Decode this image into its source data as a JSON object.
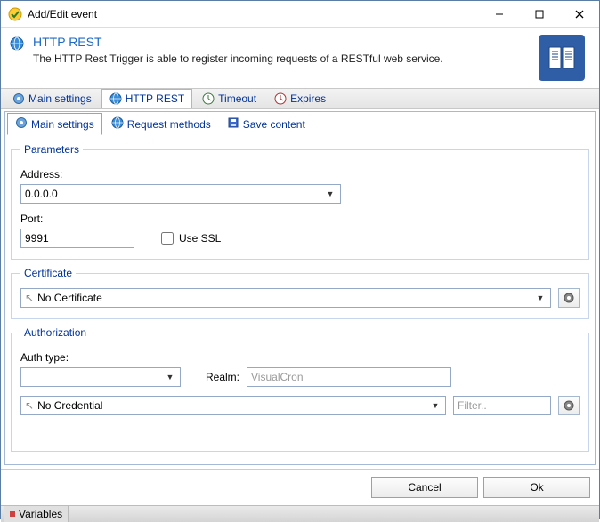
{
  "window": {
    "title": "Add/Edit event"
  },
  "header": {
    "title": "HTTP REST",
    "description": "The HTTP Rest Trigger is able to register incoming requests of a RESTful web service."
  },
  "outer_tabs": {
    "items": [
      {
        "label": "Main settings"
      },
      {
        "label": "HTTP REST"
      },
      {
        "label": "Timeout"
      },
      {
        "label": "Expires"
      }
    ]
  },
  "inner_tabs": {
    "items": [
      {
        "label": "Main settings"
      },
      {
        "label": "Request methods"
      },
      {
        "label": "Save content"
      }
    ]
  },
  "parameters": {
    "legend": "Parameters",
    "address_label": "Address:",
    "address_value": "0.0.0.0",
    "port_label": "Port:",
    "port_value": "9991",
    "use_ssl_label": "Use SSL"
  },
  "certificate": {
    "legend": "Certificate",
    "value": "No Certificate"
  },
  "authorization": {
    "legend": "Authorization",
    "auth_type_label": "Auth type:",
    "auth_type_value": "",
    "realm_label": "Realm:",
    "realm_value": "VisualCron",
    "credential_value": "No Credential",
    "filter_placeholder": "Filter.."
  },
  "footer": {
    "cancel_label": "Cancel",
    "ok_label": "Ok"
  },
  "statusbar": {
    "variables_label": "Variables"
  }
}
